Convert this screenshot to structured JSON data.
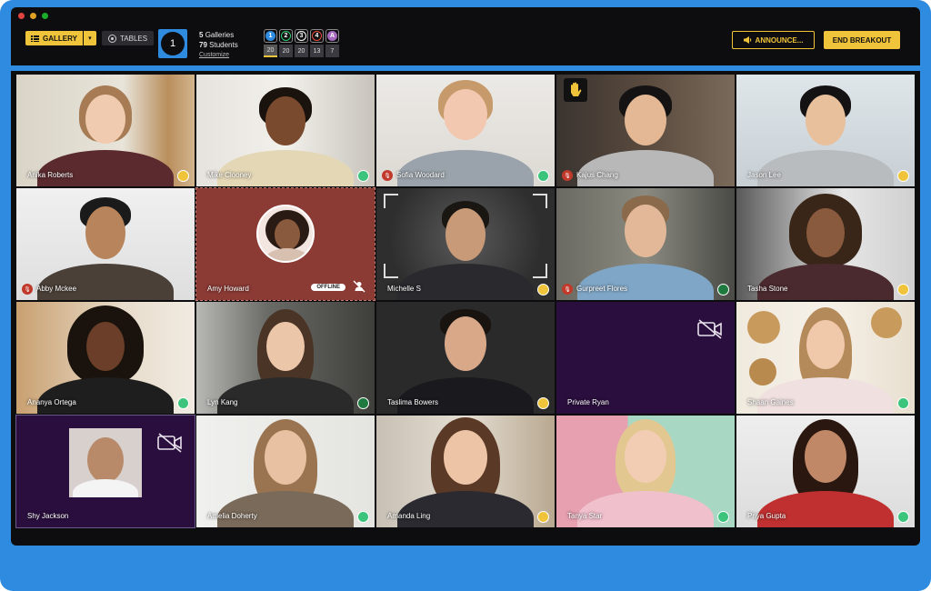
{
  "toolbar": {
    "gallery_label": "GALLERY",
    "tables_label": "TABLES",
    "room_number": "1",
    "galleries_count": "5",
    "galleries_label": "Galleries",
    "students_count": "79",
    "students_label": "Students",
    "customize_label": "Customize",
    "announce_label": "ANNOUNCE...",
    "end_breakout_label": "END BREAKOUT"
  },
  "groups": [
    {
      "number": "1",
      "color": "#2f8be0",
      "count": "20"
    },
    {
      "number": "2",
      "color": "#2ecc71",
      "count": "20"
    },
    {
      "number": "3",
      "color": "#ffffff",
      "count": "20"
    },
    {
      "number": "4",
      "color": "#e74c3c",
      "count": "13"
    },
    {
      "number": "A",
      "color": "#a569bd",
      "count": "7"
    }
  ],
  "participants": [
    {
      "name": "Anika Roberts",
      "status": "yellow"
    },
    {
      "name": "Mike Clooney",
      "status": "green"
    },
    {
      "name": "Sofia Woodard",
      "status": "green",
      "muted": true
    },
    {
      "name": "Kajus Chang",
      "status": "none",
      "muted": true,
      "hand_raised": true
    },
    {
      "name": "Jason Lee",
      "status": "yellow"
    },
    {
      "name": "Abby Mckee",
      "status": "none",
      "muted": true
    },
    {
      "name": "Amy Howard",
      "status": "offline",
      "offline_label": "OFFLINE"
    },
    {
      "name": "Michelle S",
      "status": "yellow"
    },
    {
      "name": "Gurpreet Flores",
      "status": "green-dark",
      "muted": true
    },
    {
      "name": "Tasha Stone",
      "status": "yellow"
    },
    {
      "name": "Ananya Ortega",
      "status": "green"
    },
    {
      "name": "Lyn Kang",
      "status": "green-dark"
    },
    {
      "name": "Taslima Bowers",
      "status": "yellow"
    },
    {
      "name": "Private Ryan",
      "status": "none",
      "camera_off": true
    },
    {
      "name": "Shaan Gaines",
      "status": "green"
    },
    {
      "name": "Shy Jackson",
      "status": "none",
      "camera_off": true
    },
    {
      "name": "Amelia Doherty",
      "status": "green"
    },
    {
      "name": "Amanda Ling",
      "status": "yellow"
    },
    {
      "name": "Tanya Star",
      "status": "green"
    },
    {
      "name": "Priya Gupta",
      "status": "green"
    }
  ],
  "colors": {
    "accent": "#f0c43a",
    "brand_blue": "#2f8be0",
    "status_yellow": "#f0c43a",
    "status_green": "#3cc47c",
    "status_green_dark": "#1e7a3e",
    "camera_off_bg": "#2a0f3e",
    "offline_bg": "#8b3a34"
  }
}
